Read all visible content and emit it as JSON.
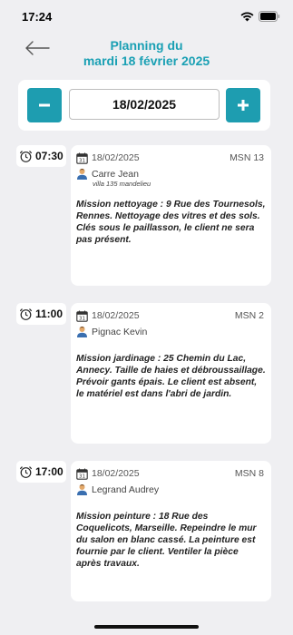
{
  "status_bar": {
    "time": "17:24"
  },
  "header": {
    "title_line1": "Planning du",
    "title_line2": "mardi 18 février 2025"
  },
  "date_bar": {
    "prev_label": "−",
    "date_value": "18/02/2025",
    "next_label": "+"
  },
  "appointments": [
    {
      "time": "07:30",
      "date": "18/02/2025",
      "msn": "MSN 13",
      "client": "Carre Jean",
      "client_sub": "villa 135 mandelieu",
      "mission": "Mission nettoyage : 9 Rue des Tournesols, Rennes. Nettoyage des vitres et des sols. Clés sous le paillasson, le client ne sera pas présent."
    },
    {
      "time": "11:00",
      "date": "18/02/2025",
      "msn": "MSN 2",
      "client": "Pignac Kevin",
      "client_sub": "",
      "mission": "Mission jardinage : 25 Chemin du Lac, Annecy. Taille de haies et débroussaillage. Prévoir gants épais. Le client est absent, le matériel est dans l'abri de jardin."
    },
    {
      "time": "17:00",
      "date": "18/02/2025",
      "msn": "MSN 8",
      "client": "Legrand Audrey",
      "client_sub": "",
      "mission": "Mission peinture : 18 Rue des Coquelicots, Marseille. Repeindre le mur du salon en blanc cassé. La peinture est fournie par le client. Ventiler la pièce après travaux."
    }
  ],
  "icons": {
    "time": "alarm-clock-icon",
    "date": "calendar-icon",
    "client": "person-icon",
    "back": "arrow-left-icon"
  },
  "colors": {
    "accent": "#1aa0b4",
    "button": "#1e9db0",
    "background": "#efeff2"
  }
}
